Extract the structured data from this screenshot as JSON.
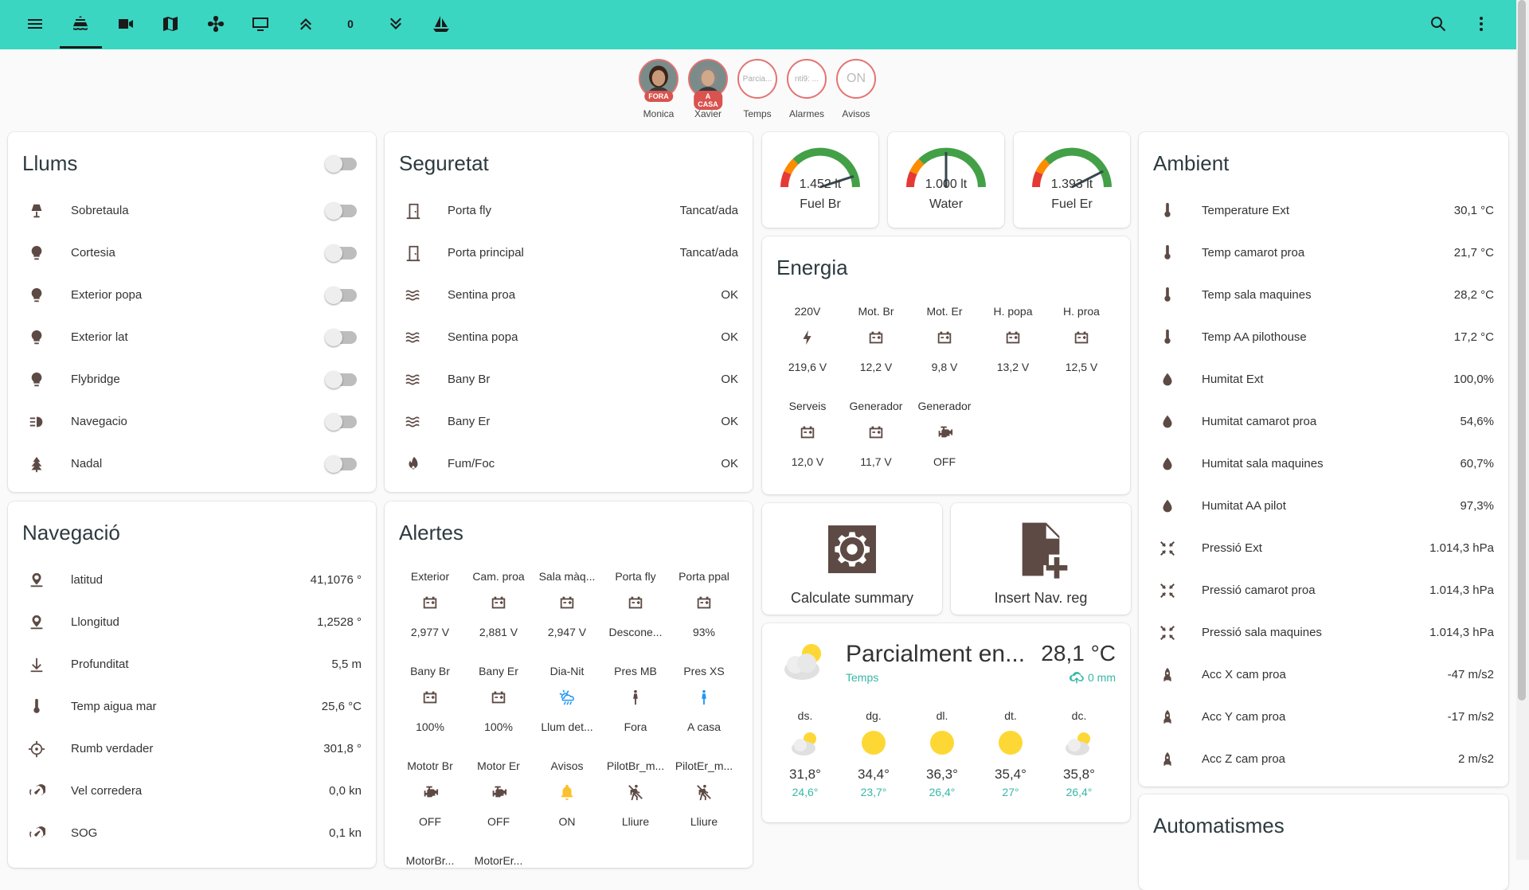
{
  "toolbar": {
    "tabs": [
      "menu-icon",
      "ship-icon",
      "video-icon",
      "map-icon",
      "fan-icon",
      "monitor-icon",
      "chevron-double-up-icon",
      "zero-tab",
      "chevron-double-down-icon",
      "sailboat-icon"
    ],
    "zero_label": "0",
    "accent_color": "#3ad6c2"
  },
  "badges": [
    {
      "name": "Monica",
      "tag": "FORA",
      "content": ""
    },
    {
      "name": "Xavier",
      "tag": "A CASA",
      "content": ""
    },
    {
      "name": "Temps",
      "tag": "",
      "content": "Parcia..."
    },
    {
      "name": "Alarmes",
      "tag": "",
      "content": "nti9: ..."
    },
    {
      "name": "Avisos",
      "tag": "",
      "content": "ON"
    }
  ],
  "llums": {
    "title": "Llums",
    "items": [
      {
        "label": "Sobretaula",
        "icon": "lamp-icon"
      },
      {
        "label": "Cortesia",
        "icon": "bulb-icon"
      },
      {
        "label": "Exterior popa",
        "icon": "bulb-icon"
      },
      {
        "label": "Exterior lat",
        "icon": "bulb-icon"
      },
      {
        "label": "Flybridge",
        "icon": "bulb-icon"
      },
      {
        "label": "Navegacio",
        "icon": "headlight-icon"
      },
      {
        "label": "Nadal",
        "icon": "tree-icon"
      }
    ]
  },
  "seguretat": {
    "title": "Seguretat",
    "items": [
      {
        "label": "Porta fly",
        "value": "Tancat/ada",
        "icon": "door-icon"
      },
      {
        "label": "Porta principal",
        "value": "Tancat/ada",
        "icon": "door-icon"
      },
      {
        "label": "Sentina proa",
        "value": "OK",
        "icon": "water-icon"
      },
      {
        "label": "Sentina popa",
        "value": "OK",
        "icon": "water-icon"
      },
      {
        "label": "Bany Br",
        "value": "OK",
        "icon": "water-icon"
      },
      {
        "label": "Bany Er",
        "value": "OK",
        "icon": "water-icon"
      },
      {
        "label": "Fum/Foc",
        "value": "OK",
        "icon": "fire-icon"
      }
    ]
  },
  "gauges": [
    {
      "name": "Fuel Br",
      "value": "1.452 lt",
      "level": 0.9
    },
    {
      "name": "Water",
      "value": "1.000 lt",
      "level": 0.5
    },
    {
      "name": "Fuel Er",
      "value": "1.393 lt",
      "level": 0.85
    }
  ],
  "energia": {
    "title": "Energia",
    "cells": [
      {
        "label": "220V",
        "value": "219,6 V",
        "icon": "flash-icon"
      },
      {
        "label": "Mot. Br",
        "value": "12,2 V",
        "icon": "battery-icon"
      },
      {
        "label": "Mot. Er",
        "value": "9,8 V",
        "icon": "battery-icon"
      },
      {
        "label": "H. popa",
        "value": "13,2 V",
        "icon": "battery-icon"
      },
      {
        "label": "H. proa",
        "value": "12,5 V",
        "icon": "battery-icon"
      },
      {
        "label": "Serveis",
        "value": "12,0 V",
        "icon": "battery-icon"
      },
      {
        "label": "Generador",
        "value": "11,7 V",
        "icon": "battery-icon"
      },
      {
        "label": "Generador",
        "value": "OFF",
        "icon": "engine-icon"
      }
    ]
  },
  "ambient": {
    "title": "Ambient",
    "items": [
      {
        "label": "Temperature Ext",
        "value": "30,1 °C",
        "icon": "thermometer-icon"
      },
      {
        "label": "Temp camarot proa",
        "value": "21,7 °C",
        "icon": "thermometer-icon"
      },
      {
        "label": "Temp sala maquines",
        "value": "28,2 °C",
        "icon": "thermometer-icon"
      },
      {
        "label": "Temp AA pilothouse",
        "value": "17,2 °C",
        "icon": "thermometer-icon"
      },
      {
        "label": "Humitat Ext",
        "value": "100,0%",
        "icon": "drop-icon"
      },
      {
        "label": "Humitat camarot proa",
        "value": "54,6%",
        "icon": "drop-icon"
      },
      {
        "label": "Humitat sala maquines",
        "value": "60,7%",
        "icon": "drop-icon"
      },
      {
        "label": "Humitat AA pilot",
        "value": "97,3%",
        "icon": "drop-icon"
      },
      {
        "label": "Pressió Ext",
        "value": "1.014,3 hPa",
        "icon": "pressure-icon"
      },
      {
        "label": "Pressió camarot proa",
        "value": "1.014,3 hPa",
        "icon": "pressure-icon"
      },
      {
        "label": "Pressió sala maquines",
        "value": "1.014,3 hPa",
        "icon": "pressure-icon"
      },
      {
        "label": "Acc X cam proa",
        "value": "-47 m/s2",
        "icon": "rocket-icon"
      },
      {
        "label": "Acc Y cam proa",
        "value": "-17 m/s2",
        "icon": "rocket-icon"
      },
      {
        "label": "Acc Z cam proa",
        "value": "2 m/s2",
        "icon": "rocket-icon"
      }
    ]
  },
  "navegacio": {
    "title": "Navegació",
    "items": [
      {
        "label": "latitud",
        "value": "41,1076 °",
        "icon": "pin-icon"
      },
      {
        "label": "Llongitud",
        "value": "1,2528 °",
        "icon": "pin-icon"
      },
      {
        "label": "Profunditat",
        "value": "5,5 m",
        "icon": "arrow-down-icon"
      },
      {
        "label": "Temp aigua mar",
        "value": "25,6 °C",
        "icon": "thermometer-icon"
      },
      {
        "label": "Rumb verdader",
        "value": "301,8 °",
        "icon": "helm-icon"
      },
      {
        "label": "Vel corredera",
        "value": "0,0 kn",
        "icon": "speedometer-icon"
      },
      {
        "label": "SOG",
        "value": "0,1 kn",
        "icon": "speedometer-icon"
      }
    ]
  },
  "alertes": {
    "title": "Alertes",
    "cells": [
      {
        "label": "Exterior",
        "value": "2,977 V",
        "icon": "battery-icon"
      },
      {
        "label": "Cam. proa",
        "value": "2,881 V",
        "icon": "battery-icon"
      },
      {
        "label": "Sala màq...",
        "value": "2,947 V",
        "icon": "battery-icon"
      },
      {
        "label": "Porta fly",
        "value": "Descone...",
        "icon": "battery-icon"
      },
      {
        "label": "Porta ppal",
        "value": "93%",
        "icon": "battery-icon"
      },
      {
        "label": "Bany Br",
        "value": "100%",
        "icon": "battery-icon"
      },
      {
        "label": "Bany Er",
        "value": "100%",
        "icon": "battery-icon"
      },
      {
        "label": "Dia-Nit",
        "value": "Llum det...",
        "icon": "weather-icon"
      },
      {
        "label": "Pres MB",
        "value": "Fora",
        "icon": "person-icon"
      },
      {
        "label": "Pres XS",
        "value": "A casa",
        "icon": "person-icon"
      },
      {
        "label": "Mototr Br",
        "value": "OFF",
        "icon": "engine-icon"
      },
      {
        "label": "Motor Er",
        "value": "OFF",
        "icon": "engine-icon"
      },
      {
        "label": "Avisos",
        "value": "ON",
        "icon": "bell-icon"
      },
      {
        "label": "PilotBr_m...",
        "value": "Lliure",
        "icon": "nohands-icon"
      },
      {
        "label": "PilotEr_m...",
        "value": "Lliure",
        "icon": "nohands-icon"
      },
      {
        "label": "MotorBr...",
        "value": "",
        "icon": ""
      },
      {
        "label": "MotorEr...",
        "value": "",
        "icon": ""
      }
    ]
  },
  "actions": {
    "summary": "Calculate summary",
    "insert": "Insert Nav. reg"
  },
  "weather": {
    "condition": "Parcialment en...",
    "temperature": "28,1 °C",
    "source": "Temps",
    "precip": "0 mm",
    "forecast": [
      {
        "day": "ds.",
        "hi": "31,8°",
        "lo": "24,6°",
        "icon": "partly-cloudy-icon"
      },
      {
        "day": "dg.",
        "hi": "34,4°",
        "lo": "23,7°",
        "icon": "sun-icon"
      },
      {
        "day": "dl.",
        "hi": "36,3°",
        "lo": "26,4°",
        "icon": "sun-icon"
      },
      {
        "day": "dt.",
        "hi": "35,4°",
        "lo": "27°",
        "icon": "sun-icon"
      },
      {
        "day": "dc.",
        "hi": "35,8°",
        "lo": "26,4°",
        "icon": "partly-cloudy-icon"
      }
    ]
  },
  "automatismes": {
    "title": "Automatismes"
  }
}
